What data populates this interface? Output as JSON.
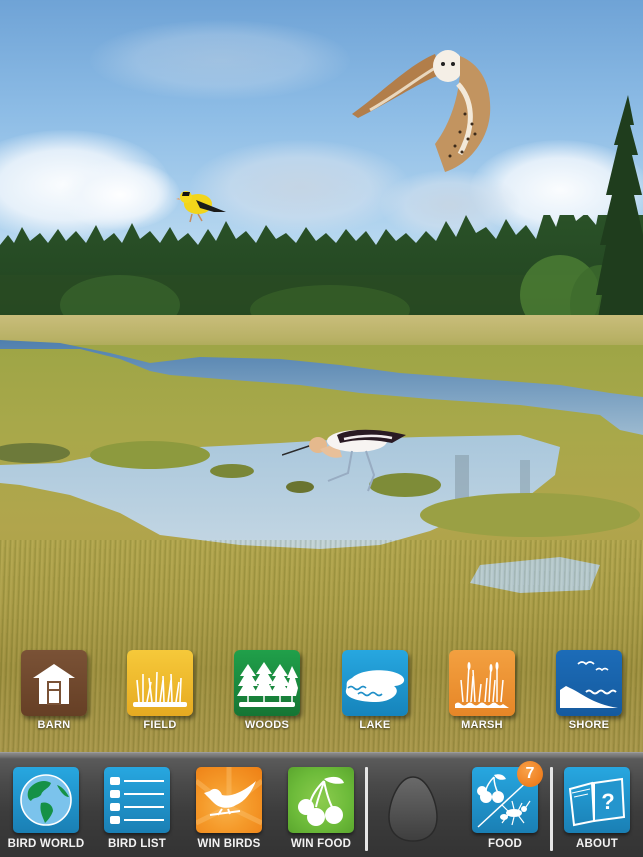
{
  "scene": {
    "description": "Salt marsh habitat with forest and sky",
    "birds": [
      {
        "name": "Barn Owl",
        "icon": "barn-owl"
      },
      {
        "name": "American Goldfinch",
        "icon": "goldfinch"
      },
      {
        "name": "American Avocet",
        "icon": "avocet"
      }
    ]
  },
  "habitats": [
    {
      "label": "BARN",
      "icon": "barn-icon",
      "color": "#6f4a2e"
    },
    {
      "label": "FIELD",
      "icon": "field-grass-icon",
      "color": "#f0b92a"
    },
    {
      "label": "WOODS",
      "icon": "woods-trees-icon",
      "color": "#1a8a3c"
    },
    {
      "label": "LAKE",
      "icon": "lake-icon",
      "color": "#1f9bd6"
    },
    {
      "label": "MARSH",
      "icon": "marsh-reeds-icon",
      "color": "#ef9433"
    },
    {
      "label": "SHORE",
      "icon": "shore-icon",
      "color": "#1a64ad"
    }
  ],
  "toolbar": {
    "items": [
      {
        "label": "BIRD WORLD",
        "icon": "globe-icon",
        "color": "#1f9bd6"
      },
      {
        "label": "BIRD LIST",
        "icon": "list-icon",
        "color": "#1f9bd6"
      },
      {
        "label": "WIN BIRDS",
        "icon": "bird-icon",
        "color": "#f18a1c"
      },
      {
        "label": "WIN FOOD",
        "icon": "cherries-icon",
        "color": "#6dbb3a"
      },
      {
        "label": "FOOD",
        "icon": "food-icon",
        "color": "#1f9bd6",
        "badge": "7"
      },
      {
        "label": "ABOUT",
        "icon": "book-question-icon",
        "color": "#1f9bd6"
      }
    ],
    "egg_slot": "empty-egg",
    "badge_color": "#ef7f1f"
  }
}
